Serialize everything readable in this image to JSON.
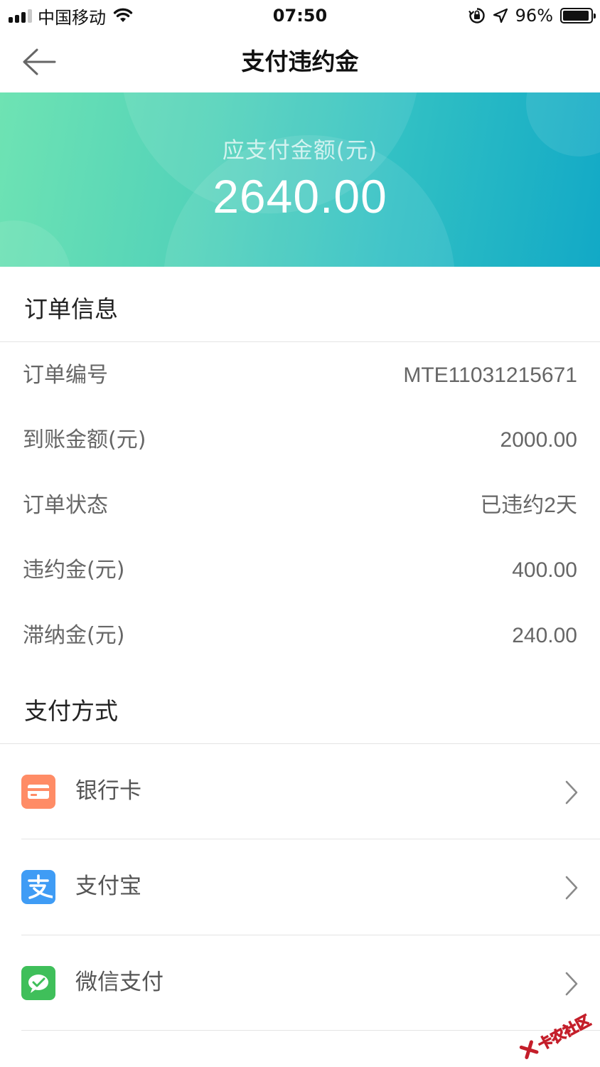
{
  "status_bar": {
    "carrier": "中国移动",
    "time": "07:50",
    "battery_percent": "96%",
    "battery_level": 0.96
  },
  "nav": {
    "title": "支付违约金"
  },
  "banner": {
    "label": "应支付金额(元)",
    "amount": "2640.00"
  },
  "order_info": {
    "title": "订单信息",
    "rows": [
      {
        "label": "订单编号",
        "value": "MTE11031215671"
      },
      {
        "label": "到账金额(元)",
        "value": "2000.00"
      },
      {
        "label": "订单状态",
        "value": "已违约2天"
      },
      {
        "label": "违约金(元)",
        "value": "400.00"
      },
      {
        "label": "滞纳金(元)",
        "value": "240.00"
      }
    ]
  },
  "payment": {
    "title": "支付方式",
    "methods": [
      {
        "label": "银行卡",
        "icon": "bank-card-icon",
        "color": "#ff8c66"
      },
      {
        "label": "支付宝",
        "icon": "alipay-icon",
        "color": "#3f9cf5"
      },
      {
        "label": "微信支付",
        "icon": "wechat-pay-icon",
        "color": "#3fbf5a"
      }
    ]
  },
  "watermark": {
    "text": "卡农社区"
  }
}
